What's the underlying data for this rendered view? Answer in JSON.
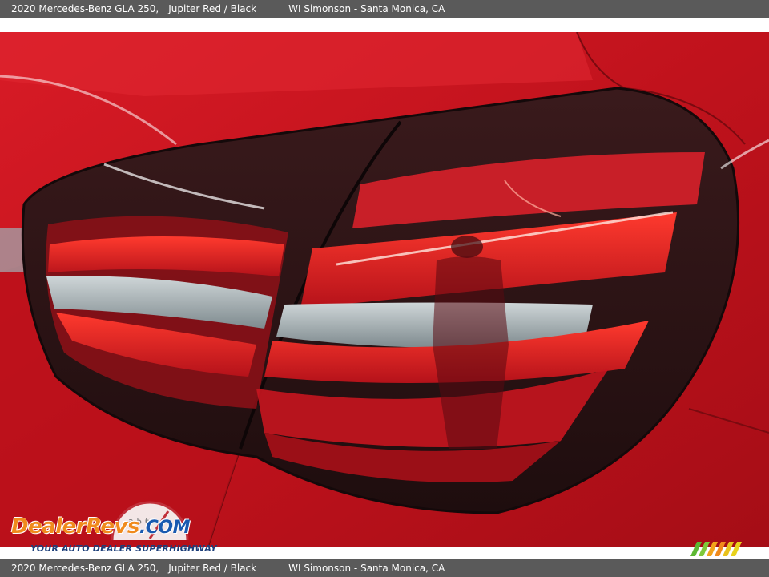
{
  "header": {
    "vehicle": "2020 Mercedes-Benz GLA 250,",
    "color": "Jupiter Red / Black",
    "dealer": "WI Simonson - Santa Monica, CA"
  },
  "footer": {
    "vehicle": "2020 Mercedes-Benz GLA 250,",
    "color": "Jupiter Red / Black",
    "dealer": "WI Simonson - Santa Monica, CA"
  },
  "watermark": {
    "brand_left": "DealerRevs",
    "brand_right": ".COM",
    "tagline": "YOUR AUTO DEALER SUPERHIGHWAY",
    "gauge_digits": "a 5 6"
  },
  "colors": {
    "bar": "#5a5a5a",
    "paint": "#c8151f",
    "lens_dark": "#2a1416",
    "brand_orange": "#f08a1c",
    "brand_blue": "#1a5ab0"
  }
}
